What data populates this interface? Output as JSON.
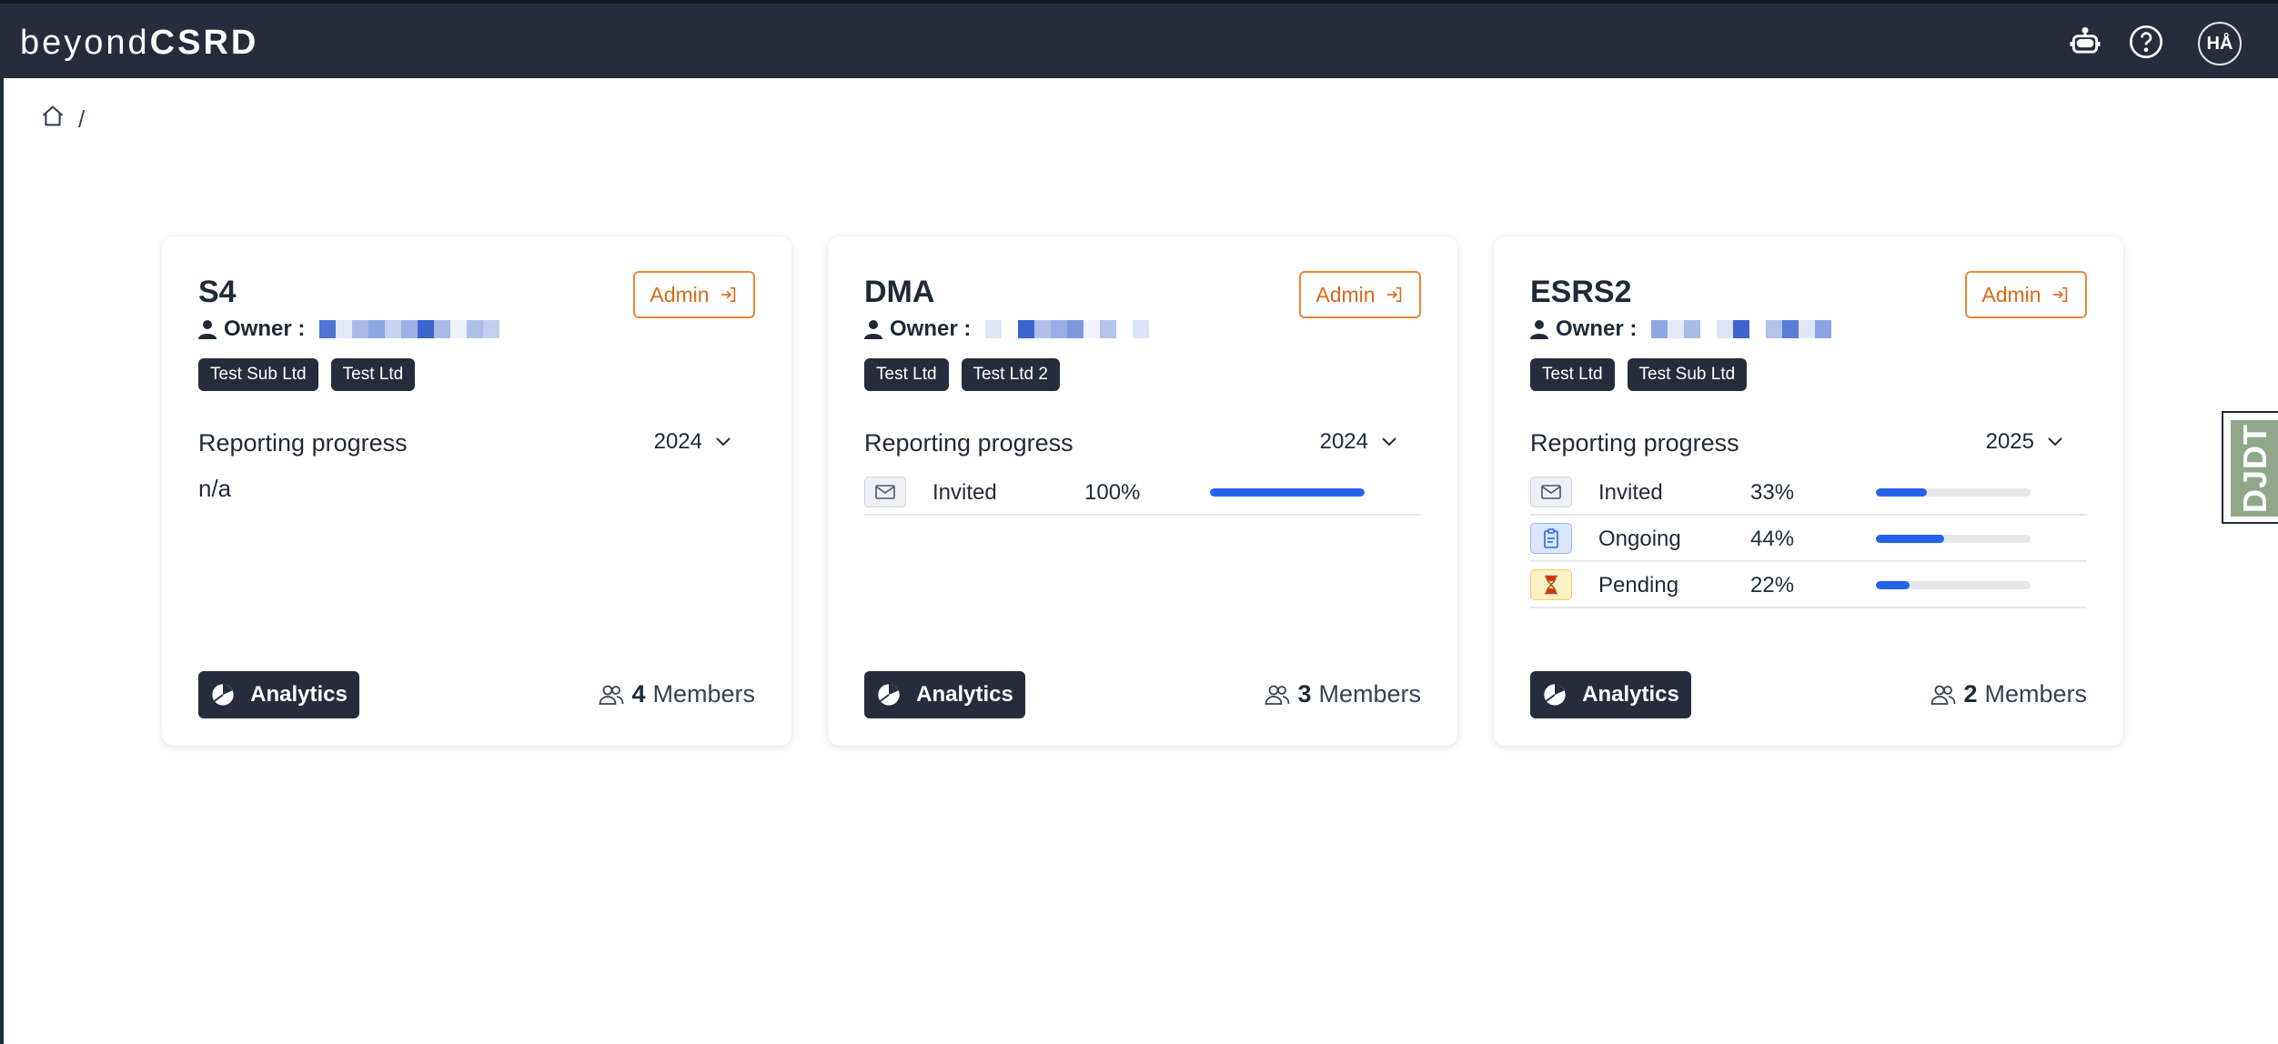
{
  "app": {
    "logo_light": "beyond",
    "logo_bold": "CSRD",
    "avatar_initials": "HÅ"
  },
  "breadcrumb": {
    "separator": "/"
  },
  "colors": {
    "topbar": "#252d3c",
    "accent_orange": "#d96a1c",
    "progress_blue": "#2563eb",
    "chip_bg": "#252d3c"
  },
  "icons": {
    "assistant": "robot-icon",
    "help": "question-circle-icon",
    "home": "home-icon",
    "owner": "user-icon",
    "admin": "sign-in-icon",
    "year": "chevron-down-icon",
    "analytics": "pie-chart-icon",
    "members": "users-icon",
    "invited": "envelope-icon",
    "ongoing": "clipboard-icon",
    "pending": "hourglass-icon"
  },
  "cards": [
    {
      "title": "S4",
      "owner_label": "Owner :",
      "admin_label": "Admin",
      "tags": [
        "Test Sub Ltd",
        "Test Ltd"
      ],
      "progress_label": "Reporting progress",
      "year": "2024",
      "empty_text": "n/a",
      "rows": [],
      "analytics_label": "Analytics",
      "members_count": "4",
      "members_label": "Members"
    },
    {
      "title": "DMA",
      "owner_label": "Owner :",
      "admin_label": "Admin",
      "tags": [
        "Test Ltd",
        "Test Ltd 2"
      ],
      "progress_label": "Reporting progress",
      "year": "2024",
      "rows": [
        {
          "label": "Invited",
          "percent": "100%",
          "fraction": 1.0
        }
      ],
      "analytics_label": "Analytics",
      "members_count": "3",
      "members_label": "Members"
    },
    {
      "title": "ESRS2",
      "owner_label": "Owner :",
      "admin_label": "Admin",
      "tags": [
        "Test Ltd",
        "Test Sub Ltd"
      ],
      "progress_label": "Reporting progress",
      "year": "2025",
      "rows": [
        {
          "label": "Invited",
          "percent": "33%",
          "fraction": 0.33
        },
        {
          "label": "Ongoing",
          "percent": "44%",
          "fraction": 0.44
        },
        {
          "label": "Pending",
          "percent": "22%",
          "fraction": 0.22
        }
      ],
      "analytics_label": "Analytics",
      "members_count": "2",
      "members_label": "Members"
    }
  ],
  "debug_toolbar": {
    "label": "DJDT"
  }
}
